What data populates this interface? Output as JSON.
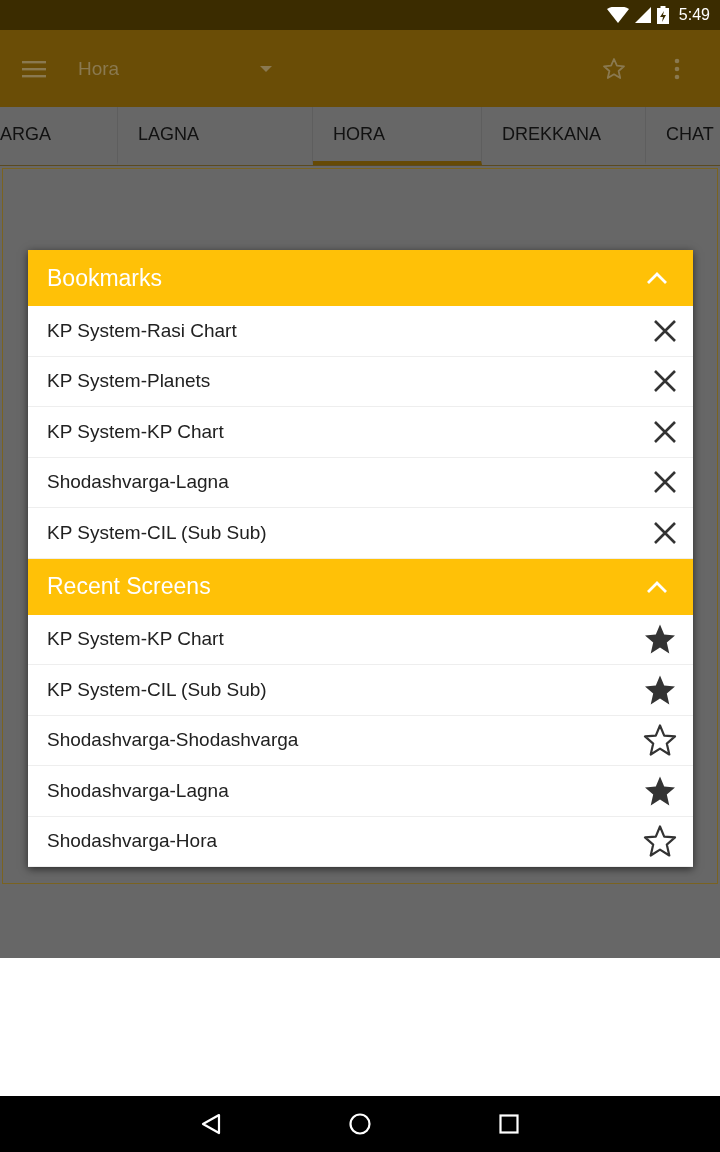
{
  "status_bar": {
    "time": "5:49"
  },
  "toolbar": {
    "title": "Hora"
  },
  "tabs": [
    {
      "label": "ARGA",
      "selected": false
    },
    {
      "label": "LAGNA",
      "selected": false
    },
    {
      "label": "HORA",
      "selected": true
    },
    {
      "label": "DREKKANA",
      "selected": false
    },
    {
      "label": "CHAT",
      "selected": false
    }
  ],
  "dialog": {
    "sections": [
      {
        "kind": "bookmarks",
        "title": "Bookmarks",
        "expanded": true,
        "items": [
          {
            "label": "KP System-Rasi Chart"
          },
          {
            "label": "KP System-Planets"
          },
          {
            "label": "KP System-KP Chart"
          },
          {
            "label": "Shodashvarga-Lagna"
          },
          {
            "label": "KP System-CIL (Sub Sub)"
          }
        ]
      },
      {
        "kind": "recent",
        "title": "Recent Screens",
        "expanded": true,
        "items": [
          {
            "label": "KP System-KP Chart",
            "starred": true
          },
          {
            "label": "KP System-CIL (Sub Sub)",
            "starred": true
          },
          {
            "label": "Shodashvarga-Shodashvarga",
            "starred": false
          },
          {
            "label": "Shodashvarga-Lagna",
            "starred": true
          },
          {
            "label": "Shodashvarga-Hora",
            "starred": false
          }
        ]
      }
    ]
  }
}
